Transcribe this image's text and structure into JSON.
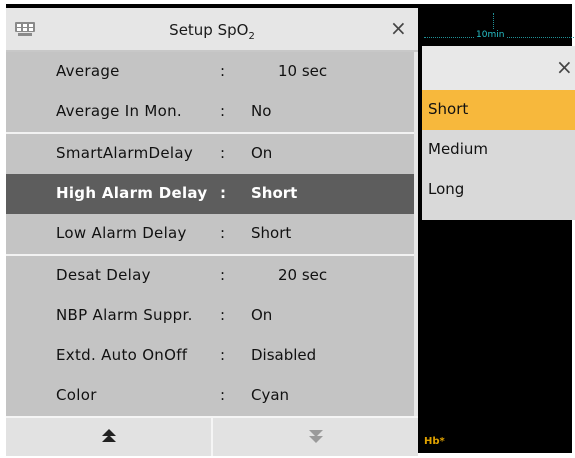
{
  "monitor": {
    "time_scale": "10min",
    "hb_label": "Hb*"
  },
  "panel": {
    "title_main": "Setup SpO",
    "title_sub": "2",
    "close_glyph": "×",
    "icon": "monitor-settings-icon",
    "rows": [
      {
        "label": "Average",
        "value": "10 sec",
        "selected": false
      },
      {
        "label": "Average In Mon.",
        "value": "No",
        "selected": false
      },
      {
        "label": "SmartAlarmDelay",
        "value": "On",
        "selected": false
      },
      {
        "label": "High Alarm Delay",
        "value": "Short",
        "selected": true
      },
      {
        "label": "Low Alarm Delay",
        "value": "Short",
        "selected": false
      },
      {
        "label": "Desat Delay",
        "value": "20 sec",
        "selected": false
      },
      {
        "label": "NBP Alarm Suppr.",
        "value": "On",
        "selected": false
      },
      {
        "label": "Extd. Auto OnOff",
        "value": "Disabled",
        "selected": false
      },
      {
        "label": "Color",
        "value": "Cyan",
        "selected": false
      }
    ],
    "colon": ":",
    "footer": {
      "page_up_icon": "page-up-icon",
      "page_down_icon": "page-down-icon"
    }
  },
  "popup": {
    "close_glyph": "×",
    "options": [
      "Short",
      "Medium",
      "Long"
    ],
    "selected": "Short"
  },
  "colors": {
    "selected_row": "#5d5d5d",
    "selected_option": "#f7b83c",
    "wave": "#27c0c8",
    "hb": "#e0a200"
  }
}
